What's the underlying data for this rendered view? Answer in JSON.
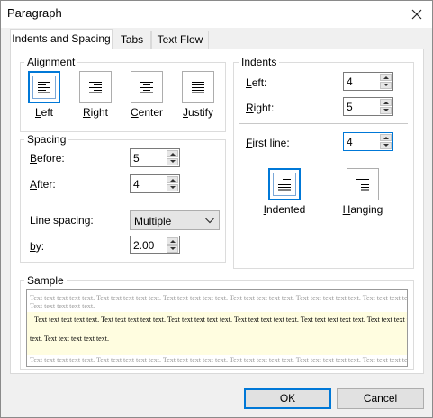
{
  "window": {
    "title": "Paragraph"
  },
  "tabs": [
    {
      "label": "Indents and Spacing",
      "active": true
    },
    {
      "label": "Tabs",
      "active": false
    },
    {
      "label": "Text Flow",
      "active": false
    }
  ],
  "alignment": {
    "group_label": "Alignment",
    "options": [
      {
        "label_ul": "L",
        "label_rest": "eft",
        "icon": "align-left-icon",
        "selected": true
      },
      {
        "label_ul": "R",
        "label_rest": "ight",
        "icon": "align-right-icon",
        "selected": false
      },
      {
        "label_ul": "C",
        "label_rest": "enter",
        "icon": "align-center-icon",
        "selected": false
      },
      {
        "label_ul": "J",
        "label_rest": "ustify",
        "icon": "align-justify-icon",
        "selected": false
      }
    ]
  },
  "spacing": {
    "group_label": "Spacing",
    "before": {
      "label_ul": "B",
      "label_rest": "efore:",
      "value": "5"
    },
    "after": {
      "label_ul": "A",
      "label_rest": "fter:",
      "value": "4"
    },
    "line_spacing": {
      "label": "Line spacing:",
      "value": "Multiple"
    },
    "by": {
      "label_ul": "b",
      "label_rest": "y:",
      "value": "2.00"
    }
  },
  "indents": {
    "group_label": "Indents",
    "left": {
      "label_ul": "L",
      "label_rest": "eft:",
      "value": "4"
    },
    "right": {
      "label_ul": "R",
      "label_rest": "ight:",
      "value": "5"
    },
    "first_line": {
      "label_ul": "F",
      "label_rest": "irst line:",
      "value": "4"
    },
    "indented": {
      "label_ul": "I",
      "label_rest": "ndented",
      "icon": "indented-icon",
      "selected": true
    },
    "hanging": {
      "label_ul": "H",
      "label_rest": "anging",
      "icon": "hanging-icon",
      "selected": false
    }
  },
  "sample": {
    "group_label": "Sample",
    "grey_lines": [
      "Text text text text text. Text text text text text. Text text text text text. Text text text text text. Text text text text text. Text text text text text.",
      "Text text text text text."
    ],
    "main_lines": [
      "Text text text text text. Text text text text text. Text text text text text. Text text text text text. Text text text text text. Text text text text text.",
      "text. Text text text text text."
    ],
    "grey_after": "Text text text text text. Text text text text text. Text text text text text. Text text text text text. Text text text text text. Text text text text text."
  },
  "buttons": {
    "ok": "OK",
    "cancel": "Cancel"
  },
  "colors": {
    "accent": "#0078d7",
    "sample_highlight": "#fffde0"
  }
}
